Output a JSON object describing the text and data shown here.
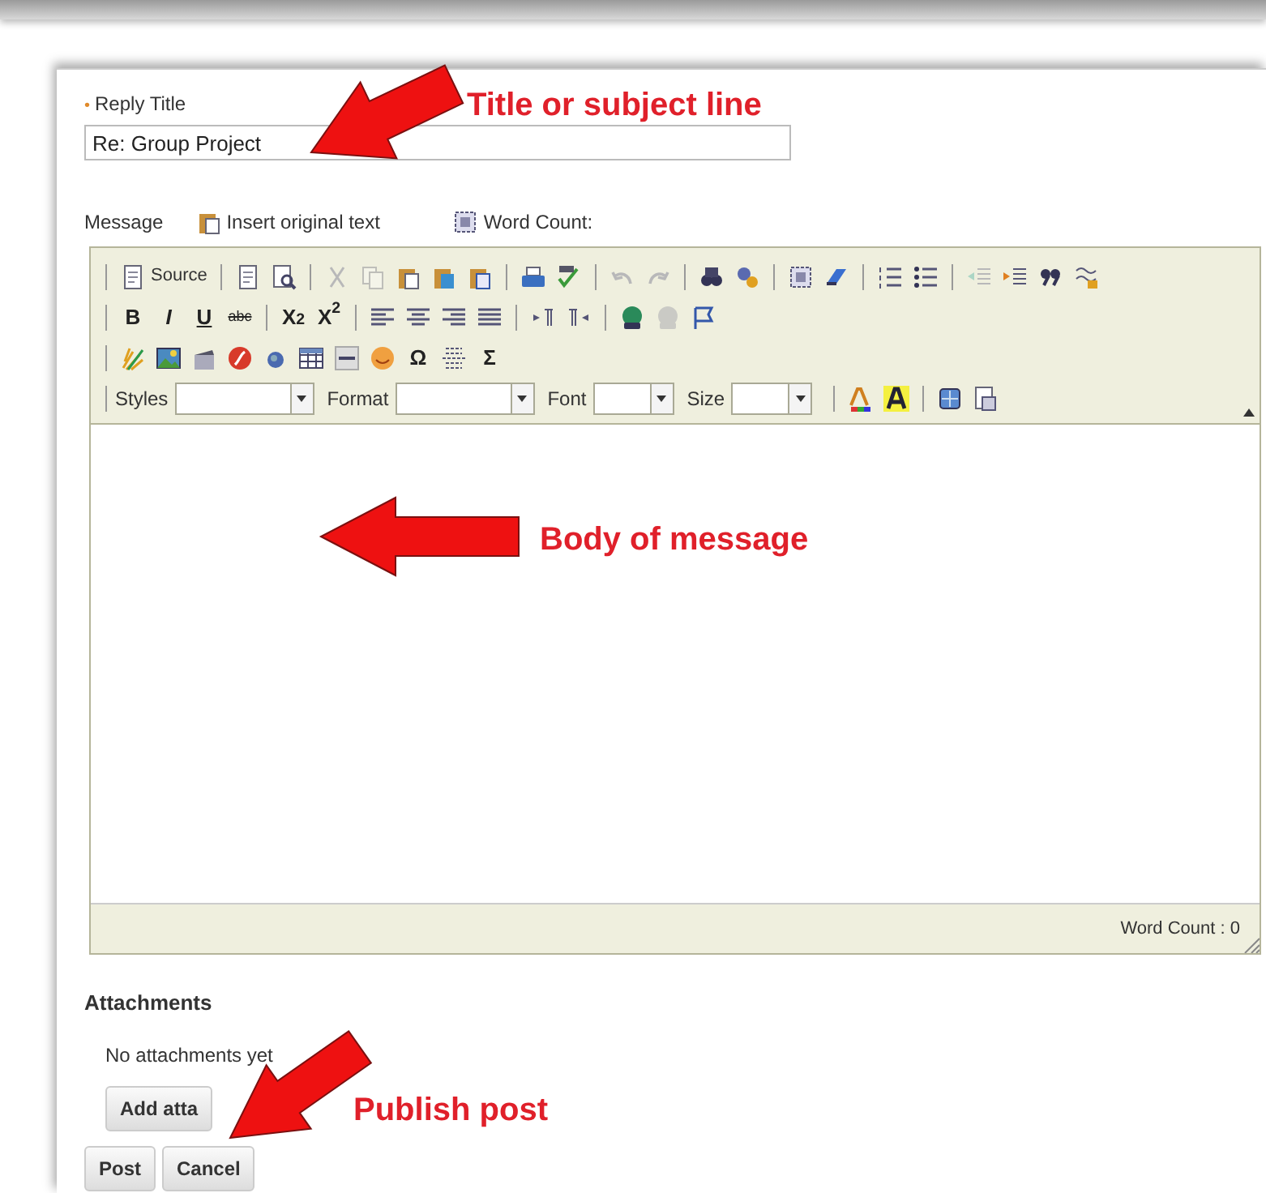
{
  "reply_title": {
    "required_mark": "•",
    "label": "Reply Title",
    "value": "Re: Group Project"
  },
  "message": {
    "label": "Message",
    "links": [
      {
        "text": "Insert original text"
      },
      {
        "text": "Word Count:"
      }
    ]
  },
  "editor": {
    "toolbar": [
      [
        [
          {
            "kind": "label-button",
            "text": "Source"
          }
        ],
        [
          {
            "kind": "icon",
            "disabled": false
          },
          {
            "kind": "icon",
            "disabled": false
          }
        ],
        [
          {
            "kind": "icon",
            "disabled": true
          },
          {
            "kind": "icon",
            "disabled": true
          },
          {
            "kind": "icon",
            "disabled": false
          },
          {
            "kind": "icon",
            "disabled": false
          },
          {
            "kind": "icon",
            "disabled": false
          }
        ],
        [
          {
            "kind": "icon",
            "disabled": false
          },
          {
            "kind": "icon",
            "disabled": false
          }
        ],
        [
          {
            "kind": "icon",
            "disabled": true
          },
          {
            "kind": "icon",
            "disabled": true
          }
        ],
        [
          {
            "kind": "icon",
            "disabled": false
          },
          {
            "kind": "icon",
            "disabled": false
          }
        ],
        [
          {
            "kind": "icon",
            "disabled": false
          },
          {
            "kind": "icon",
            "disabled": false
          }
        ],
        [
          {
            "kind": "icon",
            "disabled": false
          },
          {
            "kind": "icon",
            "disabled": false
          }
        ],
        [
          {
            "kind": "icon",
            "disabled": true
          },
          {
            "kind": "icon",
            "disabled": false
          },
          {
            "kind": "icon",
            "disabled": false
          },
          {
            "kind": "icon",
            "disabled": false
          }
        ]
      ],
      [
        [
          {
            "kind": "glyph",
            "text": "B"
          },
          {
            "kind": "glyph",
            "text": "I"
          },
          {
            "kind": "glyph",
            "text": "U"
          },
          {
            "kind": "glyph",
            "text": "abc"
          }
        ],
        [
          {
            "kind": "glyph",
            "text": "X$_{2}$"
          },
          {
            "kind": "glyph",
            "text": "X$^{2}$"
          }
        ],
        [
          {
            "kind": "icon",
            "disabled": false
          },
          {
            "kind": "icon",
            "disabled": false
          },
          {
            "kind": "icon",
            "disabled": false
          },
          {
            "kind": "icon",
            "disabled": false
          }
        ],
        [
          {
            "kind": "icon",
            "disabled": false
          },
          {
            "kind": "icon",
            "disabled": false
          }
        ],
        [
          {
            "kind": "icon",
            "disabled": false
          },
          {
            "kind": "icon",
            "disabled": true
          },
          {
            "kind": "icon",
            "disabled": false
          }
        ]
      ],
      [
        [
          {
            "kind": "icon",
            "disabled": false
          },
          {
            "kind": "icon",
            "disabled": false
          },
          {
            "kind": "icon",
            "disabled": false
          },
          {
            "kind": "icon",
            "disabled": false
          },
          {
            "kind": "icon",
            "disabled": false
          },
          {
            "kind": "icon",
            "disabled": false
          },
          {
            "kind": "icon",
            "disabled": false
          },
          {
            "kind": "icon",
            "disabled": false
          },
          {
            "kind": "glyph",
            "text": "Ω"
          },
          {
            "kind": "icon",
            "disabled": false
          },
          {
            "kind": "glyph",
            "text": "Σ"
          }
        ]
      ],
      [
        [
          {
            "kind": "combo",
            "label": "Styles"
          },
          {
            "kind": "combo",
            "label": "Format"
          },
          {
            "kind": "combo",
            "label": "Font"
          },
          {
            "kind": "combo",
            "label": "Size"
          }
        ],
        [
          {
            "kind": "icon",
            "disabled": false
          },
          {
            "kind": "icon",
            "disabled": false
          }
        ],
        [
          {
            "kind": "icon",
            "disabled": false
          },
          {
            "kind": "icon",
            "disabled": false
          }
        ]
      ]
    ],
    "word_count": "Word Count : 0"
  },
  "attachments": {
    "heading": "Attachments",
    "empty_text": "No attachments yet",
    "button": "Add atta"
  },
  "buttons": [
    "Post",
    "Cancel"
  ],
  "annotations": [
    {
      "text": "Title or subject line"
    },
    {
      "text": "Body of message"
    },
    {
      "text": "Publish post"
    }
  ]
}
